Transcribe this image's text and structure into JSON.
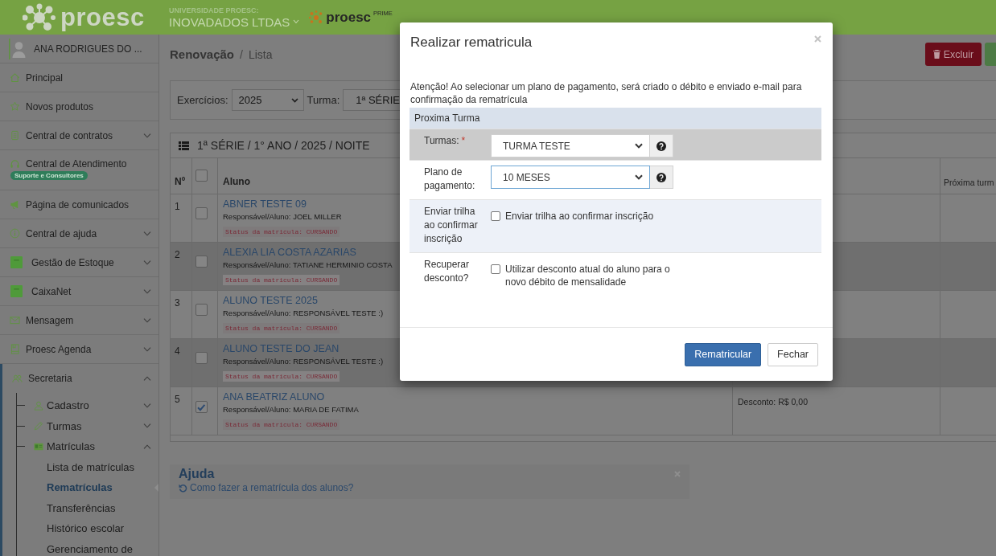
{
  "header": {
    "logo": "proesc",
    "institution_label": "UNIVERSIDADE PROESC:",
    "institution": "INOVADADOS LTDAS",
    "product_logo": "proesc",
    "product_tag": "PRIME"
  },
  "sidebar": {
    "user": "ANA RODRIGUES DO ...",
    "items": [
      {
        "label": "Principal"
      },
      {
        "label": "Novos produtos"
      },
      {
        "label": "Central de contratos",
        "expanded": false
      },
      {
        "label": "Central de Atendimento",
        "badge": "Suporte e Consultores"
      },
      {
        "label": "Página de comunicados"
      },
      {
        "label": "Central de ajuda",
        "expanded": false
      },
      {
        "label": "Gestão de Estoque",
        "expanded": false
      },
      {
        "label": "CaixaNet",
        "expanded": false
      },
      {
        "label": "Mensagem",
        "expanded": false
      },
      {
        "label": "Proesc Agenda",
        "expanded": false
      },
      {
        "label": "Secretaria",
        "expanded": true,
        "children": [
          {
            "label": "Cadastro",
            "expanded": false
          },
          {
            "label": "Turmas",
            "expanded": false
          },
          {
            "label": "Matrículas",
            "expanded": true,
            "children": [
              {
                "label": "Lista de matrículas",
                "selected": false
              },
              {
                "label": "Rematrículas",
                "selected": true
              },
              {
                "label": "Transferências",
                "selected": false
              },
              {
                "label": "Histórico escolar",
                "selected": false
              },
              {
                "label": "Gerenciamento de",
                "selected": false
              }
            ]
          }
        ]
      }
    ]
  },
  "breadcrumb": {
    "section": "Renovação",
    "separator": "/",
    "page": "Lista"
  },
  "actions": [
    {
      "kind": "danger",
      "label": "Excluir"
    },
    {
      "kind": "success"
    }
  ],
  "filters": [
    {
      "label": "Exercícios:",
      "value": "2025"
    },
    {
      "label": "Turma:",
      "value": "1ª SÉRIE"
    }
  ],
  "table": {
    "title": "1ª SÉRIE / 1° ANO / 2025 / NOITE",
    "columns": [
      {
        "kind": "text",
        "label": "Nº"
      },
      {
        "kind": "checkbox",
        "checked": false
      },
      {
        "kind": "text",
        "label": "Aluno"
      },
      {
        "kind": "blank"
      },
      {
        "kind": "text",
        "label": "Próxima turm"
      }
    ],
    "rows": [
      {
        "number": "1",
        "checked": false,
        "name": "ABNER TESTE 09",
        "responsible": "Responsável/Aluno: JOEL MILLER",
        "status": "Status da matricula: CURSANDO"
      },
      {
        "number": "2",
        "checked": false,
        "name": "ALEXIA LIA COSTA AZARIAS",
        "responsible": "Responsável/Aluno: TATIANE HERMINIO COSTA",
        "status": "Status da matricula: CURSANDO"
      },
      {
        "number": "3",
        "checked": false,
        "name": "ALUNO TESTE 2025",
        "responsible": "Responsável/Aluno: RESPONSÁVEL TESTE :)",
        "status": "Status da matricula: CURSANDO"
      },
      {
        "number": "4",
        "checked": false,
        "name": "ALUNO TESTE DO JEAN",
        "responsible": "Responsável/Aluno: RESPONSÁVEL TESTE :)",
        "status": "Status da matricula: CURSANDO"
      },
      {
        "number": "5",
        "checked": true,
        "name": "ANA BEATRIZ ALUNO",
        "responsible": "Responsável/Aluno: MARIA DE FATIMA",
        "status": "Status da matricula: CURSANDO",
        "discount": "Desconto: R$ 0,00"
      }
    ]
  },
  "help": {
    "title": "Ajuda",
    "link": "Como fazer a rematrícula dos alunos?"
  },
  "modal": {
    "title": "Realizar rematricula",
    "notice": "Atenção! Ao selecionar um plano de pagamento, será criado o débito e enviado e-mail para confirmação da rematrícula",
    "section": "Proxima Turma",
    "fields": [
      {
        "kind": "select",
        "label": "Turmas:",
        "required_mark": "*",
        "value": "TURMA TESTE",
        "focused": false,
        "highlighted": true
      },
      {
        "kind": "select",
        "label": "Plano de pagamento:",
        "value": "10 MESES",
        "focused": true,
        "highlighted": false
      },
      {
        "kind": "checkbox",
        "label": "Enviar trilha ao confirmar inscrição",
        "option": "Enviar trilha ao confirmar inscrição",
        "checked": false,
        "highlighted": false
      },
      {
        "kind": "checkbox",
        "label": "Recuperar desconto?",
        "option": "Utilizar desconto atual do aluno para o novo débito de mensalidade",
        "checked": false,
        "highlighted": false
      }
    ],
    "buttons": [
      {
        "kind": "primary",
        "label": "Rematricular"
      },
      {
        "kind": "default",
        "label": "Fechar"
      }
    ]
  }
}
